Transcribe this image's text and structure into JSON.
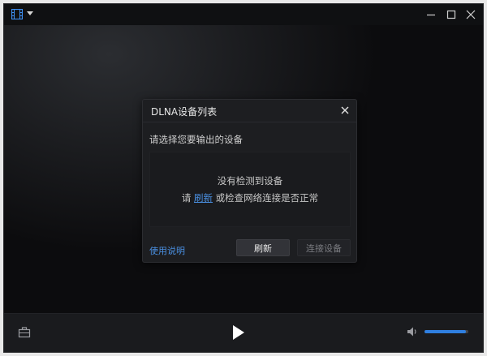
{
  "titlebar": {
    "app_icon": "film-icon",
    "menu_icon": "caret-down-icon",
    "controls": [
      "minimize-icon",
      "maximize-icon",
      "close-icon"
    ]
  },
  "dialog": {
    "title": "DLNA设备列表",
    "close_icon": "close-icon",
    "prompt": "请选择您要输出的设备",
    "empty_message": "没有检测到设备",
    "hint_prefix": "请 ",
    "hint_link": "刷新",
    "hint_suffix": " 或检查网络连接是否正常",
    "help_link": "使用说明",
    "refresh_button": "刷新",
    "connect_button": "连接设备"
  },
  "controls": {
    "toolbox_icon": "toolbox-icon",
    "play_icon": "play-icon",
    "volume_icon": "volume-icon",
    "volume_level": 0.94
  },
  "colors": {
    "accent": "#4a90e2",
    "volume_fill": "#2f7fe0",
    "background": "#111214",
    "dialog_bg": "#1d1e21"
  }
}
